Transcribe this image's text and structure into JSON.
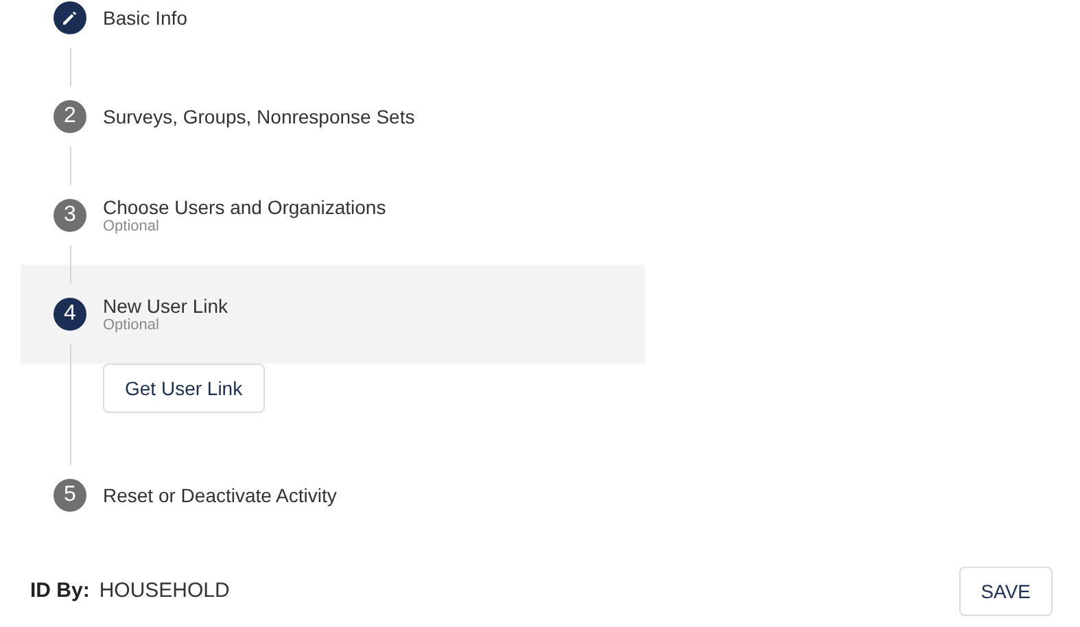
{
  "steps": [
    {
      "kind": "edit",
      "title": "Basic Info",
      "selected": false
    },
    {
      "kind": "number",
      "number": "2",
      "title": "Surveys, Groups, Nonresponse Sets",
      "selected": false
    },
    {
      "kind": "number",
      "number": "3",
      "title": "Choose Users and Organizations",
      "subtitle": "Optional",
      "selected": false
    },
    {
      "kind": "number",
      "number": "4",
      "title": "New User Link",
      "subtitle": "Optional",
      "selected": true,
      "button": "Get User Link"
    },
    {
      "kind": "number",
      "number": "5",
      "title": "Reset or Deactivate Activity",
      "selected": false
    }
  ],
  "footer": {
    "label": "ID By:",
    "value": "HOUSEHOLD",
    "button": "SAVE"
  }
}
